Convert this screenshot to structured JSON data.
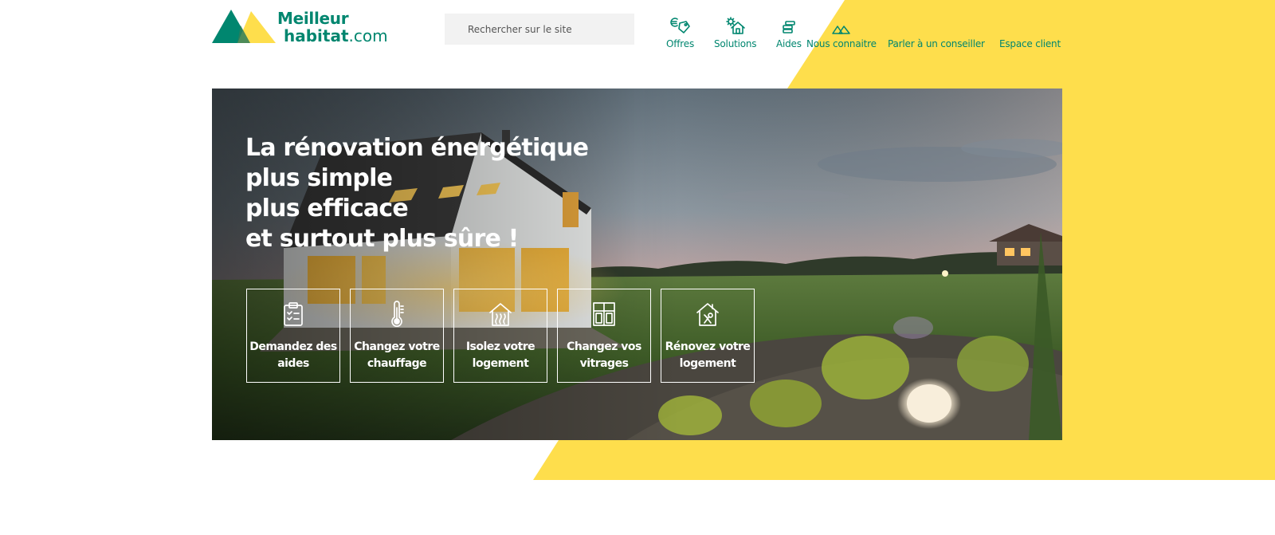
{
  "brand": {
    "line1": "Meilleur",
    "line2_bold": "habitat",
    "line2_suffix": ".com",
    "teal": "#00866f",
    "yellow": "#fede4c"
  },
  "search": {
    "placeholder": "Rechercher sur le site",
    "icon": "search-icon"
  },
  "nav": {
    "items": [
      {
        "label": "Offres",
        "icon": "euro-tag-icon"
      },
      {
        "label": "Solutions",
        "icon": "house-gear-icon"
      },
      {
        "label": "Aides",
        "icon": "coin-stack-icon"
      },
      {
        "label": "Nous connaitre",
        "icon": "mountains-logo-icon"
      },
      {
        "label": "Parler à un conseiller",
        "icon": ""
      },
      {
        "label": "Espace client",
        "icon": ""
      }
    ]
  },
  "hero": {
    "image": "house-at-dusk-photo",
    "headline": [
      "La rénovation énergétique",
      "plus simple",
      "plus efficace",
      "et surtout plus sûre !"
    ],
    "cards": [
      {
        "line1": "Demandez des",
        "line2": "aides",
        "icon": "clipboard-checklist-icon"
      },
      {
        "line1": "Changez votre",
        "line2": "chauffage",
        "icon": "thermometer-icon"
      },
      {
        "line1": "Isolez votre",
        "line2": "logement",
        "icon": "house-heat-icon"
      },
      {
        "line1": "Changez vos",
        "line2": "vitrages",
        "icon": "window-icon"
      },
      {
        "line1": "Rénovez votre",
        "line2": "logement",
        "icon": "house-tools-icon"
      }
    ]
  }
}
